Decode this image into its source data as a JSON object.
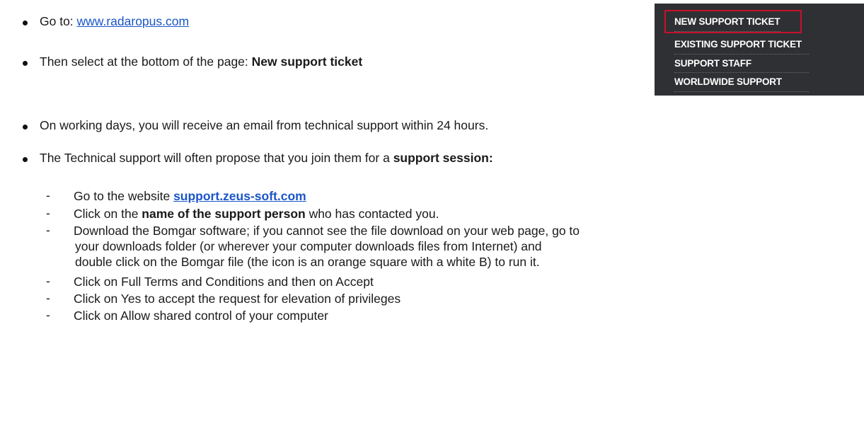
{
  "bullets": {
    "b1": {
      "prefix": "Go to:  ",
      "link": "www.radaropus.com"
    },
    "b2": {
      "prefix": "Then select at the bottom of the page:  ",
      "bold": "New support ticket"
    },
    "b3": {
      "text": "On working days, you will receive an email from technical support within 24 hours."
    },
    "b4": {
      "prefix": "The Technical support will often propose that you join them for a ",
      "bold": "support session:"
    }
  },
  "steps": [
    {
      "dash": "-",
      "prefix": "Go to the website ",
      "link": "support.zeus-soft.com"
    },
    {
      "dash": "-",
      "prefix": "Click on the ",
      "bold": "name of the support person",
      "suffix": " who has contacted you."
    },
    {
      "dash": "-",
      "line1": "Download the Bomgar software; if you cannot see the file download on your web page, go to",
      "line2": "your downloads folder (or wherever your computer downloads files from Internet) and",
      "line3": "double click on the Bomgar file (the icon is an orange square with a white B) to run it."
    },
    {
      "dash": "-",
      "text": "Click on Full Terms and Conditions and then on Accept"
    },
    {
      "dash": "-",
      "text": "Click on Yes to accept the request for elevation of privileges"
    },
    {
      "dash": "-",
      "text": "Click on Allow shared control of your computer"
    }
  ],
  "support_menu": {
    "items": [
      "NEW SUPPORT TICKET",
      "EXISTING SUPPORT TICKET",
      "SUPPORT STAFF",
      "WORLDWIDE SUPPORT"
    ],
    "highlighted": "NEW SUPPORT TICKET",
    "background": "#2f3033",
    "highlight_color": "#c8102e"
  },
  "colors": {
    "link": "#1a55c8",
    "text": "#1a1a1a"
  }
}
